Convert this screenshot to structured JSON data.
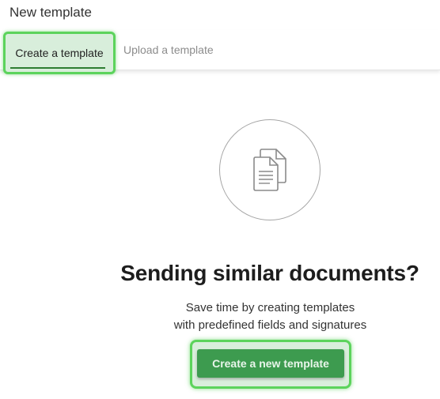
{
  "header": {
    "title": "New template"
  },
  "tabs": [
    {
      "label": "Create a template",
      "active": true
    },
    {
      "label": "Upload a template",
      "active": false
    }
  ],
  "empty_state": {
    "icon": "documents-icon",
    "headline": "Sending similar documents?",
    "subtext_line1": "Save time by creating templates",
    "subtext_line2": "with predefined fields and signatures",
    "cta_label": "Create a new template"
  },
  "colors": {
    "accent_green": "#3d9b4f",
    "highlight_green": "#5cd35c"
  }
}
